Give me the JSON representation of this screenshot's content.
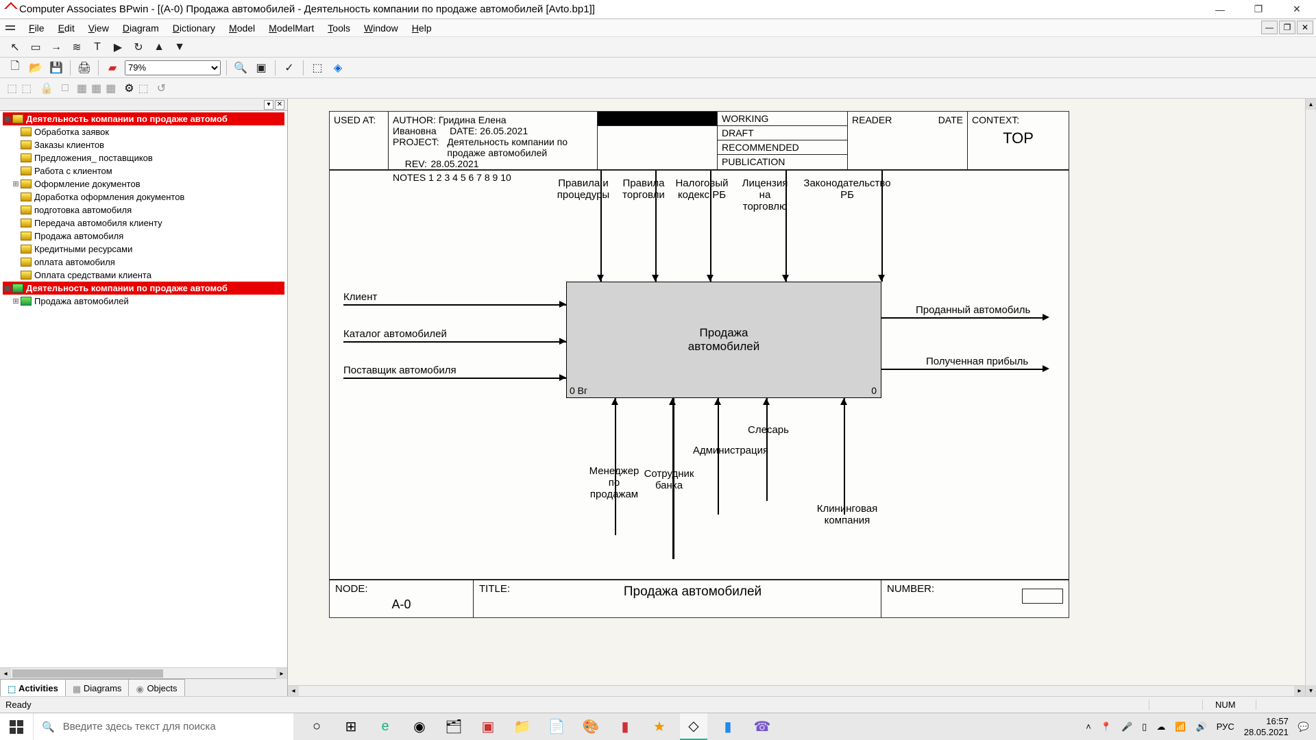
{
  "window": {
    "title": "Computer Associates BPwin - [(A-0) Продажа автомобилей - Деятельность компании по продаже автомобилей  [Avto.bp1]]"
  },
  "menubar": {
    "items": [
      "File",
      "Edit",
      "View",
      "Diagram",
      "Dictionary",
      "Model",
      "ModelMart",
      "Tools",
      "Window",
      "Help"
    ]
  },
  "toolbar": {
    "zoom_value": "79%"
  },
  "sidebar": {
    "root1": "Деятельность компании по продаже автомоб",
    "children": [
      "Обработка заявок",
      "Заказы клиентов",
      "Предложения_ поставщиков",
      "Работа с клиентом",
      "Оформление документов",
      "Доработка оформления документов",
      "подготовка автомобиля",
      "Передача автомобиля  клиенту",
      "Продажа автомобиля",
      "Кредитными  ресурсами",
      "оплата  автомобиля",
      "Оплата средствами клиента"
    ],
    "root2": "Деятельность компании по продаже автомоб",
    "child2": "Продажа автомобилей",
    "tabs": {
      "activities": "Activities",
      "diagrams": "Diagrams",
      "objects": "Objects"
    }
  },
  "idef_header": {
    "used_at": "USED AT:",
    "author_label": "AUTHOR:",
    "author": "Гридина Елена Ивановна",
    "project_label": "PROJECT:",
    "project": "Деятельность компании по продаже автомобилей",
    "notes": "NOTES  1  2  3  4  5  6  7  8  9  10",
    "date_label": "DATE:",
    "date": "26.05.2021",
    "rev_label": "REV:",
    "rev": "28.05.2021",
    "status": [
      "WORKING",
      "DRAFT",
      "RECOMMENDED",
      "PUBLICATION"
    ],
    "reader": "READER",
    "reader_date": "DATE",
    "context_label": "CONTEXT:",
    "context_value": "TOP"
  },
  "diagram": {
    "main": {
      "line1": "Продажа",
      "line2": "автомобилей",
      "node_id": "0 Bг",
      "node_num": "0"
    },
    "controls": [
      "Правила и процедуры",
      "Правила торговли",
      "Налоговый кодекс РБ",
      "Лицензия на торговлю",
      "Законодательство РБ"
    ],
    "inputs": [
      "Клиент",
      "Каталог автомобилей",
      "Поставщик автомобиля"
    ],
    "outputs": [
      "Проданный автомобиль",
      "Полученная прибыль"
    ],
    "mechanisms": [
      "Менеджер по продажам",
      "Сотрудник банка",
      "Администрация",
      "Слесарь",
      "Клининговая компания"
    ]
  },
  "idef_footer": {
    "node_label": "NODE:",
    "node_value": "A-0",
    "title_label": "TITLE:",
    "title_value": "Продажа автомобилей",
    "number_label": "NUMBER:"
  },
  "statusbar": {
    "left": "Ready",
    "num": "NUM"
  },
  "taskbar": {
    "search_placeholder": "Введите здесь текст для поиска",
    "lang": "РУС",
    "time": "16:57",
    "date": "28.05.2021"
  }
}
